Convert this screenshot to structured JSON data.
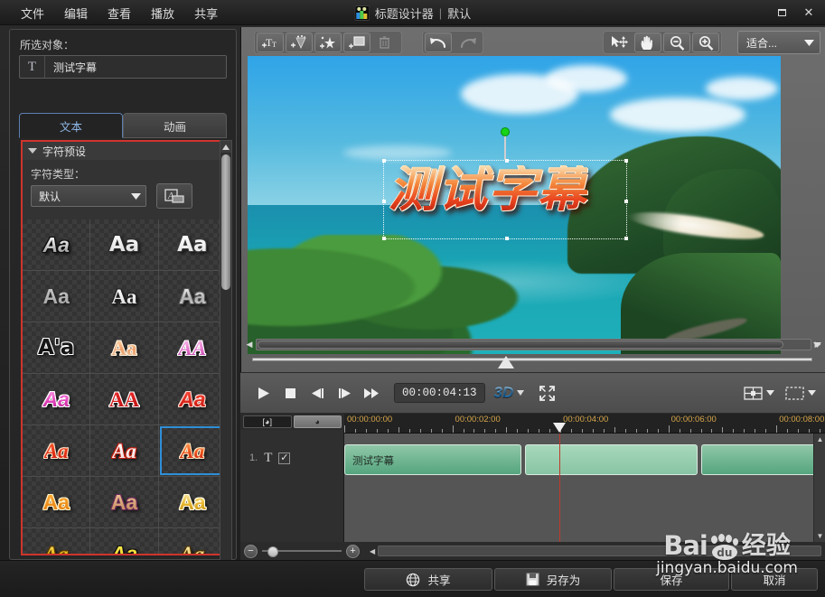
{
  "window": {
    "title": "标题设计器",
    "separator": "|",
    "preset_name": "默认",
    "app_icon": "film-camera-icon",
    "restore_label": "□",
    "close_label": "✕"
  },
  "menubar": {
    "items": [
      {
        "label": "文件",
        "name": "menu-file"
      },
      {
        "label": "编辑",
        "name": "menu-edit"
      },
      {
        "label": "查看",
        "name": "menu-view"
      },
      {
        "label": "播放",
        "name": "menu-play"
      },
      {
        "label": "共享",
        "name": "menu-share"
      }
    ]
  },
  "left_panel": {
    "selected_object_label": "所选对象：",
    "selected_object_glyph": "T",
    "selected_object_name": "测试字幕",
    "tabs": [
      {
        "label": "文本",
        "active": true
      },
      {
        "label": "动画",
        "active": false
      }
    ],
    "preset_section": {
      "header": "字符预设",
      "collapse_icon": "triangle-down-icon",
      "char_type_label": "字符类型：",
      "char_type_value": "默认",
      "char_type_options": [
        "默认"
      ],
      "manage_button_icon": "font-manage-icon",
      "highlight_color": "#d0342c",
      "selection_color": "#2f8fd8",
      "selected_index": 14,
      "thumbnail_label": "Aa",
      "thumbnails": [
        {
          "label": "Aa",
          "style": "white-chrome-italic"
        },
        {
          "label": "Aa",
          "style": "white-outline"
        },
        {
          "label": "Aa",
          "style": "white-bold-outline"
        },
        {
          "label": "Aa",
          "style": "grey-flat"
        },
        {
          "label": "Aa",
          "style": "white-serif-outline"
        },
        {
          "label": "Aa",
          "style": "silver-gradient"
        },
        {
          "label": "A'a",
          "style": "black-white-outline"
        },
        {
          "label": "Aa",
          "style": "peach-gradient"
        },
        {
          "label": "AA",
          "style": "pink-gradient"
        },
        {
          "label": "Aa",
          "style": "magenta-italic"
        },
        {
          "label": "AA",
          "style": "red-serif-outline"
        },
        {
          "label": "Aa",
          "style": "crimson-italic"
        },
        {
          "label": "Aa",
          "style": "red-bold-italic"
        },
        {
          "label": "Aa",
          "style": "white-red-shadow"
        },
        {
          "label": "Aa",
          "style": "orange-red-gradient"
        },
        {
          "label": "Aa",
          "style": "orange-solid"
        },
        {
          "label": "Aa",
          "style": "tan-purple-shadow"
        },
        {
          "label": "Aa",
          "style": "gold-gradient"
        },
        {
          "label": "Aa",
          "style": "gold-3d"
        },
        {
          "label": "Aa",
          "style": "yellow-black-outline"
        },
        {
          "label": "Aa",
          "style": "gold-serif-italic"
        }
      ]
    },
    "scrollbar": {
      "up_arrow_icon": "triangle-up-icon",
      "down_arrow_icon": "triangle-down-icon"
    }
  },
  "preview": {
    "toolbar_left": [
      {
        "name": "add-text-button",
        "icon": "add-text-icon",
        "enabled": true
      },
      {
        "name": "add-effect-button",
        "icon": "add-sparkle-icon",
        "enabled": true
      },
      {
        "name": "add-star-button",
        "icon": "add-star-icon",
        "enabled": true
      },
      {
        "name": "add-frame-button",
        "icon": "add-frame-icon",
        "enabled": true
      },
      {
        "name": "delete-button",
        "icon": "trash-icon",
        "enabled": false
      }
    ],
    "toolbar_undo": [
      {
        "name": "undo-button",
        "icon": "undo-arrow-icon",
        "enabled": true
      },
      {
        "name": "redo-button",
        "icon": "redo-arrow-icon",
        "enabled": false
      }
    ],
    "toolbar_right": [
      {
        "name": "select-tool-button",
        "icon": "select-move-icon",
        "enabled": true
      },
      {
        "name": "pan-tool-button",
        "icon": "hand-icon",
        "enabled": true
      },
      {
        "name": "zoom-out-button",
        "icon": "magnifier-minus-icon",
        "enabled": true
      },
      {
        "name": "zoom-in-button",
        "icon": "magnifier-plus-icon",
        "enabled": true
      }
    ],
    "fit_select_value": "适合...",
    "fit_select_options": [
      "适合..."
    ],
    "overlay_text": "测试字幕",
    "overlay_gradient_top": "#fbe2b6",
    "overlay_gradient_bottom": "#b8220f",
    "rotation_handle_color": "#17d417",
    "scene_description": "tropical-coastline"
  },
  "playback": {
    "buttons": [
      {
        "name": "play-button",
        "icon": "play-icon"
      },
      {
        "name": "stop-button",
        "icon": "stop-icon"
      },
      {
        "name": "previous-frame-button",
        "icon": "prev-frame-icon"
      },
      {
        "name": "next-frame-button",
        "icon": "next-frame-icon"
      },
      {
        "name": "fast-forward-button",
        "icon": "fast-forward-icon"
      }
    ],
    "timecode": "00:00:04:13",
    "mode_3d_label": "3D",
    "mode_3d_arrow": "triangle-down-icon",
    "fullscreen_icon": "expand-arrows-icon",
    "right_controls": [
      {
        "name": "grid-overlay-dropdown",
        "icon": "grid-overlay-icon"
      },
      {
        "name": "safe-area-dropdown",
        "icon": "dashed-rect-icon"
      }
    ]
  },
  "timeline": {
    "mode_buttons": [
      {
        "name": "keyframe-mode-button",
        "label": "[◕]",
        "active": false
      },
      {
        "name": "clock-mode-button",
        "label": "◕",
        "active": true
      }
    ],
    "ruler_labels": [
      "00:00:00:00",
      "00:00:02:00",
      "00:00:04:00",
      "00:00:06:00",
      "00:00:08:00"
    ],
    "playhead_time": "00:00:04:13",
    "track": {
      "number": "1.",
      "type_glyph": "T",
      "visible_checked": true,
      "check_glyph": "☑"
    },
    "clip_label": "测试字幕",
    "clips": [
      {
        "start_pct": 0,
        "width_pct": 36.8,
        "shade": "a"
      },
      {
        "start_pct": 37.5,
        "width_pct": 36.0,
        "shade": "b"
      },
      {
        "start_pct": 74.2,
        "width_pct": 25.5,
        "shade": "a"
      }
    ],
    "zoom_minus_label": "−",
    "zoom_plus_label": "+",
    "scroll_left_icon": "triangle-left-icon",
    "vscroll_up_icon": "triangle-up-icon",
    "vscroll_down_icon": "triangle-down-icon"
  },
  "footer": {
    "buttons": [
      {
        "label": "共享",
        "icon": "globe-icon",
        "name": "share-button"
      },
      {
        "label": "另存为",
        "icon": "floppy-disk-icon",
        "name": "save-as-button"
      },
      {
        "label": "保存",
        "icon": "",
        "name": "save-button"
      },
      {
        "label": "取消",
        "icon": "",
        "name": "cancel-button"
      }
    ]
  },
  "watermark": {
    "brand_left": "Bai",
    "brand_du": "du",
    "brand_right": "经验",
    "url": "jingyan.baidu.com"
  }
}
